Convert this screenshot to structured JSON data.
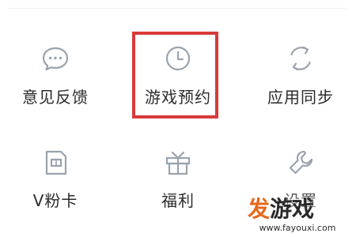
{
  "menu": {
    "items": [
      {
        "label": "意见反馈",
        "icon": "chat-bubble-icon"
      },
      {
        "label": "游戏预约",
        "icon": "clock-icon"
      },
      {
        "label": "应用同步",
        "icon": "sync-icon"
      },
      {
        "label": "V粉卡",
        "icon": "sim-card-icon"
      },
      {
        "label": "福利",
        "icon": "gift-icon"
      },
      {
        "label": "设置",
        "icon": "wrench-icon"
      }
    ]
  },
  "highlight": {
    "target": "游戏预约",
    "color": "#d93a3a"
  },
  "icon_color": "#9aa3ad",
  "watermark": {
    "brand_prefix": "发",
    "brand_suffix": "游戏",
    "url": "www.fayouxi.com",
    "accent_color": "#e6681c"
  }
}
